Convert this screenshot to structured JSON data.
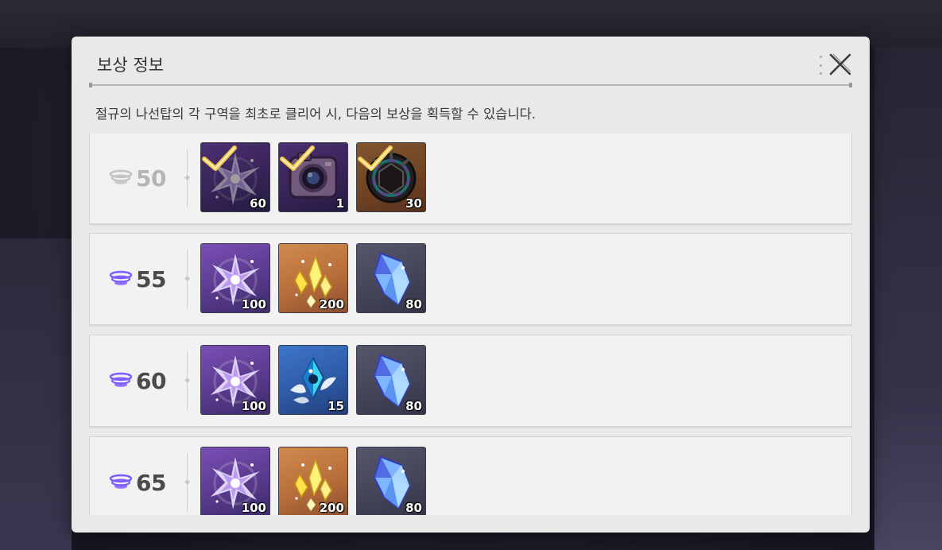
{
  "dialog": {
    "title": "보상 정보",
    "description": "절규의 나선탑의 각 구역을 최초로 클리어 시, 다음의 보상을 획득할 수 있습니다.",
    "close_icon": "close-x-icon"
  },
  "rewards": [
    {
      "stage": "50",
      "claimed": true,
      "items": [
        {
          "icon": "star-crystal-icon",
          "quantity": "60",
          "bg": "purple"
        },
        {
          "icon": "camera-device-icon",
          "quantity": "1",
          "bg": "purple"
        },
        {
          "icon": "dark-core-icon",
          "quantity": "30",
          "bg": "orange"
        }
      ]
    },
    {
      "stage": "55",
      "claimed": false,
      "items": [
        {
          "icon": "star-crystal-icon",
          "quantity": "100",
          "bg": "purple"
        },
        {
          "icon": "gold-shards-icon",
          "quantity": "200",
          "bg": "orange"
        },
        {
          "icon": "blue-crystal-icon",
          "quantity": "80",
          "bg": "gray"
        }
      ]
    },
    {
      "stage": "60",
      "claimed": false,
      "items": [
        {
          "icon": "star-crystal-icon",
          "quantity": "100",
          "bg": "purple"
        },
        {
          "icon": "winged-gem-icon",
          "quantity": "15",
          "bg": "blue"
        },
        {
          "icon": "blue-crystal-icon",
          "quantity": "80",
          "bg": "gray"
        }
      ]
    },
    {
      "stage": "65",
      "claimed": false,
      "items": [
        {
          "icon": "star-crystal-icon",
          "quantity": "100",
          "bg": "purple"
        },
        {
          "icon": "gold-shards-icon",
          "quantity": "200",
          "bg": "orange"
        },
        {
          "icon": "blue-crystal-icon",
          "quantity": "80",
          "bg": "gray"
        }
      ]
    }
  ],
  "colors": {
    "dialog_bg": "#e9e9e9",
    "row_bg": "#f2f2f2",
    "stage_icon_active": "#7d5cff",
    "check_gold": "#f4c64a"
  }
}
